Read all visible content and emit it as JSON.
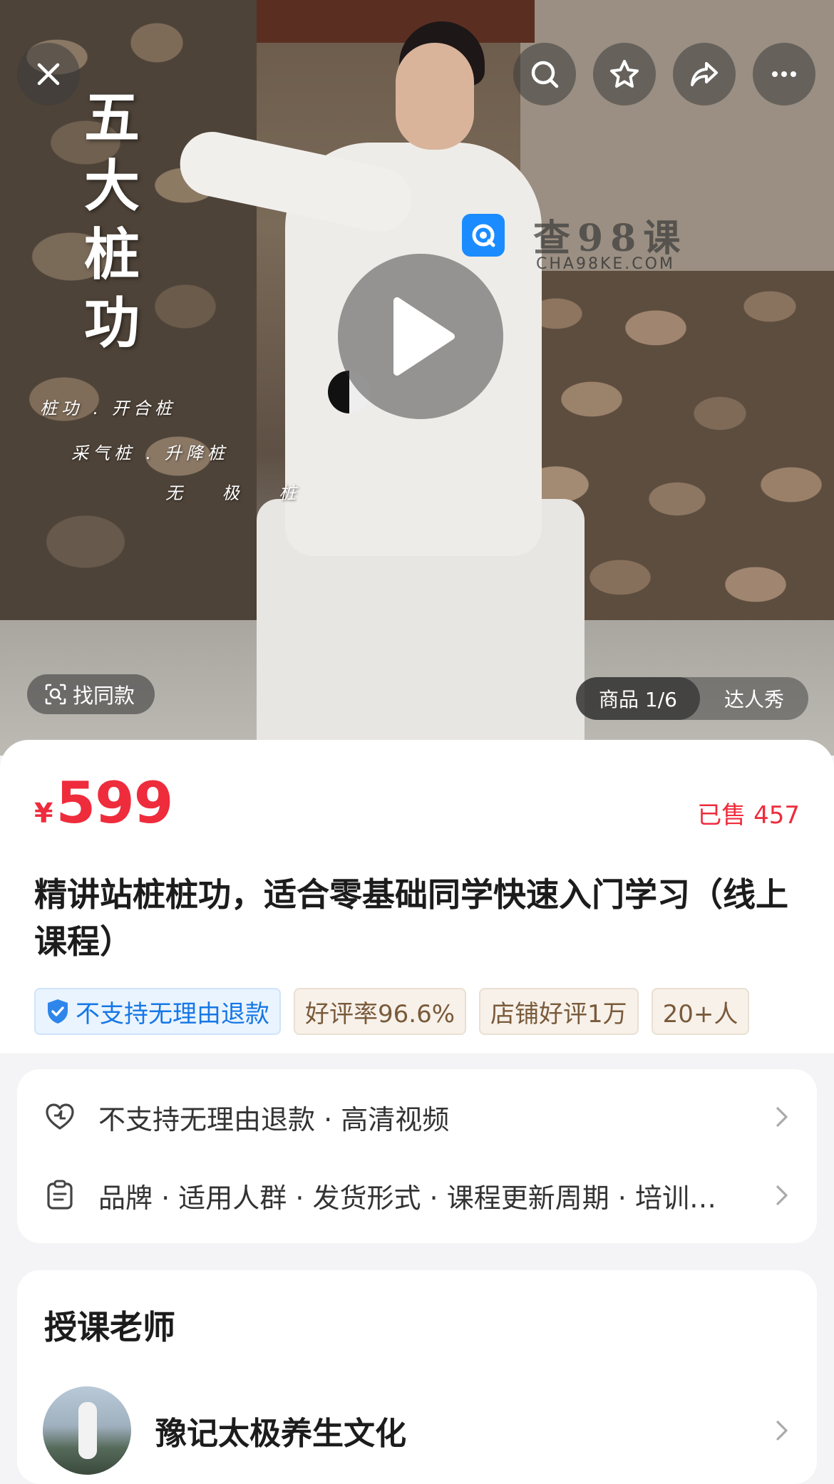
{
  "hero": {
    "poster_title": "五\n大\n桩\n功",
    "poster_lines": [
      "桩功 . 开合桩",
      "采气桩 . 升降桩",
      "无 极 桩"
    ],
    "watermark_text": "查98课",
    "watermark_sub": "CHA98KE.COM",
    "find_same_label": "找同款",
    "media_tabs": [
      "商品 1/6",
      "达人秀"
    ]
  },
  "product": {
    "currency": "¥",
    "price": "599",
    "sold": "已售 457",
    "title": "精讲站桩桩功，适合零基础同学快速入门学习（线上课程）",
    "tags": [
      {
        "text": "不支持无理由退款",
        "style": "blue",
        "icon": "shield-check-icon"
      },
      {
        "text": "好评率96.6%",
        "style": "beige"
      },
      {
        "text": "店铺好评1万",
        "style": "beige"
      },
      {
        "text": "20+人",
        "style": "beige"
      }
    ]
  },
  "service": {
    "rows": [
      {
        "icon": "heart-shield-icon",
        "text": "不支持无理由退款 · 高清视频"
      },
      {
        "icon": "clipboard-icon",
        "text": "品牌 · 适用人群 · 发货形式 · 课程更新周期 · 培训…"
      }
    ]
  },
  "teacher": {
    "section_title": "授课老师",
    "name": "豫记太极养生文化"
  },
  "colors": {
    "accent_red": "#ee2c3c",
    "tag_blue": "#1677e6",
    "tag_beige_text": "#7a5a3a",
    "page_bg": "#f4f4f6"
  }
}
